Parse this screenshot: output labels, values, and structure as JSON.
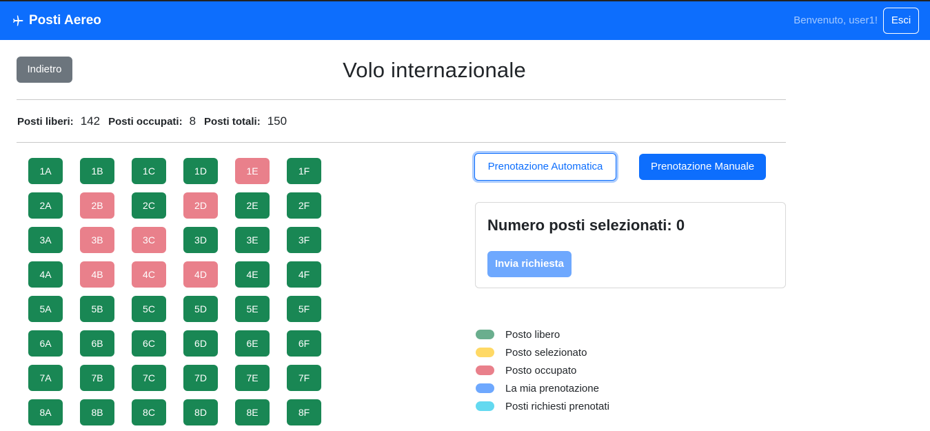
{
  "navbar": {
    "brand": "Posti Aereo",
    "brand_icon": "airplane-icon",
    "welcome": "Benvenuto, user1!",
    "logout_label": "Esci"
  },
  "page": {
    "back_label": "Indietro",
    "title": "Volo internazionale"
  },
  "stats": {
    "free_label": "Posti liberi:",
    "free_value": "142",
    "occupied_label": "Posti occupati:",
    "occupied_value": "8",
    "total_label": "Posti totali:",
    "total_value": "150"
  },
  "seats": [
    {
      "id": "1A",
      "status": "free"
    },
    {
      "id": "1B",
      "status": "free"
    },
    {
      "id": "1C",
      "status": "free"
    },
    {
      "id": "1D",
      "status": "free"
    },
    {
      "id": "1E",
      "status": "occupied"
    },
    {
      "id": "1F",
      "status": "free"
    },
    {
      "id": "2A",
      "status": "free"
    },
    {
      "id": "2B",
      "status": "occupied"
    },
    {
      "id": "2C",
      "status": "free"
    },
    {
      "id": "2D",
      "status": "occupied"
    },
    {
      "id": "2E",
      "status": "free"
    },
    {
      "id": "2F",
      "status": "free"
    },
    {
      "id": "3A",
      "status": "free"
    },
    {
      "id": "3B",
      "status": "occupied"
    },
    {
      "id": "3C",
      "status": "occupied"
    },
    {
      "id": "3D",
      "status": "free"
    },
    {
      "id": "3E",
      "status": "free"
    },
    {
      "id": "3F",
      "status": "free"
    },
    {
      "id": "4A",
      "status": "free"
    },
    {
      "id": "4B",
      "status": "occupied"
    },
    {
      "id": "4C",
      "status": "occupied"
    },
    {
      "id": "4D",
      "status": "occupied"
    },
    {
      "id": "4E",
      "status": "free"
    },
    {
      "id": "4F",
      "status": "free"
    },
    {
      "id": "5A",
      "status": "free"
    },
    {
      "id": "5B",
      "status": "free"
    },
    {
      "id": "5C",
      "status": "free"
    },
    {
      "id": "5D",
      "status": "free"
    },
    {
      "id": "5E",
      "status": "free"
    },
    {
      "id": "5F",
      "status": "free"
    },
    {
      "id": "6A",
      "status": "free"
    },
    {
      "id": "6B",
      "status": "free"
    },
    {
      "id": "6C",
      "status": "free"
    },
    {
      "id": "6D",
      "status": "free"
    },
    {
      "id": "6E",
      "status": "free"
    },
    {
      "id": "6F",
      "status": "free"
    },
    {
      "id": "7A",
      "status": "free"
    },
    {
      "id": "7B",
      "status": "free"
    },
    {
      "id": "7C",
      "status": "free"
    },
    {
      "id": "7D",
      "status": "free"
    },
    {
      "id": "7E",
      "status": "free"
    },
    {
      "id": "7F",
      "status": "free"
    },
    {
      "id": "8A",
      "status": "free"
    },
    {
      "id": "8B",
      "status": "free"
    },
    {
      "id": "8C",
      "status": "free"
    },
    {
      "id": "8D",
      "status": "free"
    },
    {
      "id": "8E",
      "status": "free"
    },
    {
      "id": "8F",
      "status": "free"
    }
  ],
  "booking": {
    "auto_label": "Prenotazione Automatica",
    "manual_label": "Prenotazione Manuale",
    "selected_title": "Numero posti selezionati: 0",
    "send_label": "Invia richiesta"
  },
  "legend": [
    {
      "label": "Posto libero",
      "color": "#6aae8e"
    },
    {
      "label": "Posto selezionato",
      "color": "#ffd965"
    },
    {
      "label": "Posto occupato",
      "color": "#e9808b"
    },
    {
      "label": "La mia prenotazione",
      "color": "#6ea8fe"
    },
    {
      "label": "Posti richiesti prenotati",
      "color": "#63d9f0"
    }
  ],
  "colors": {
    "primary": "#0d6efd",
    "seat_free": "#198754",
    "seat_occupied": "#e9808b",
    "secondary": "#6c757d"
  }
}
